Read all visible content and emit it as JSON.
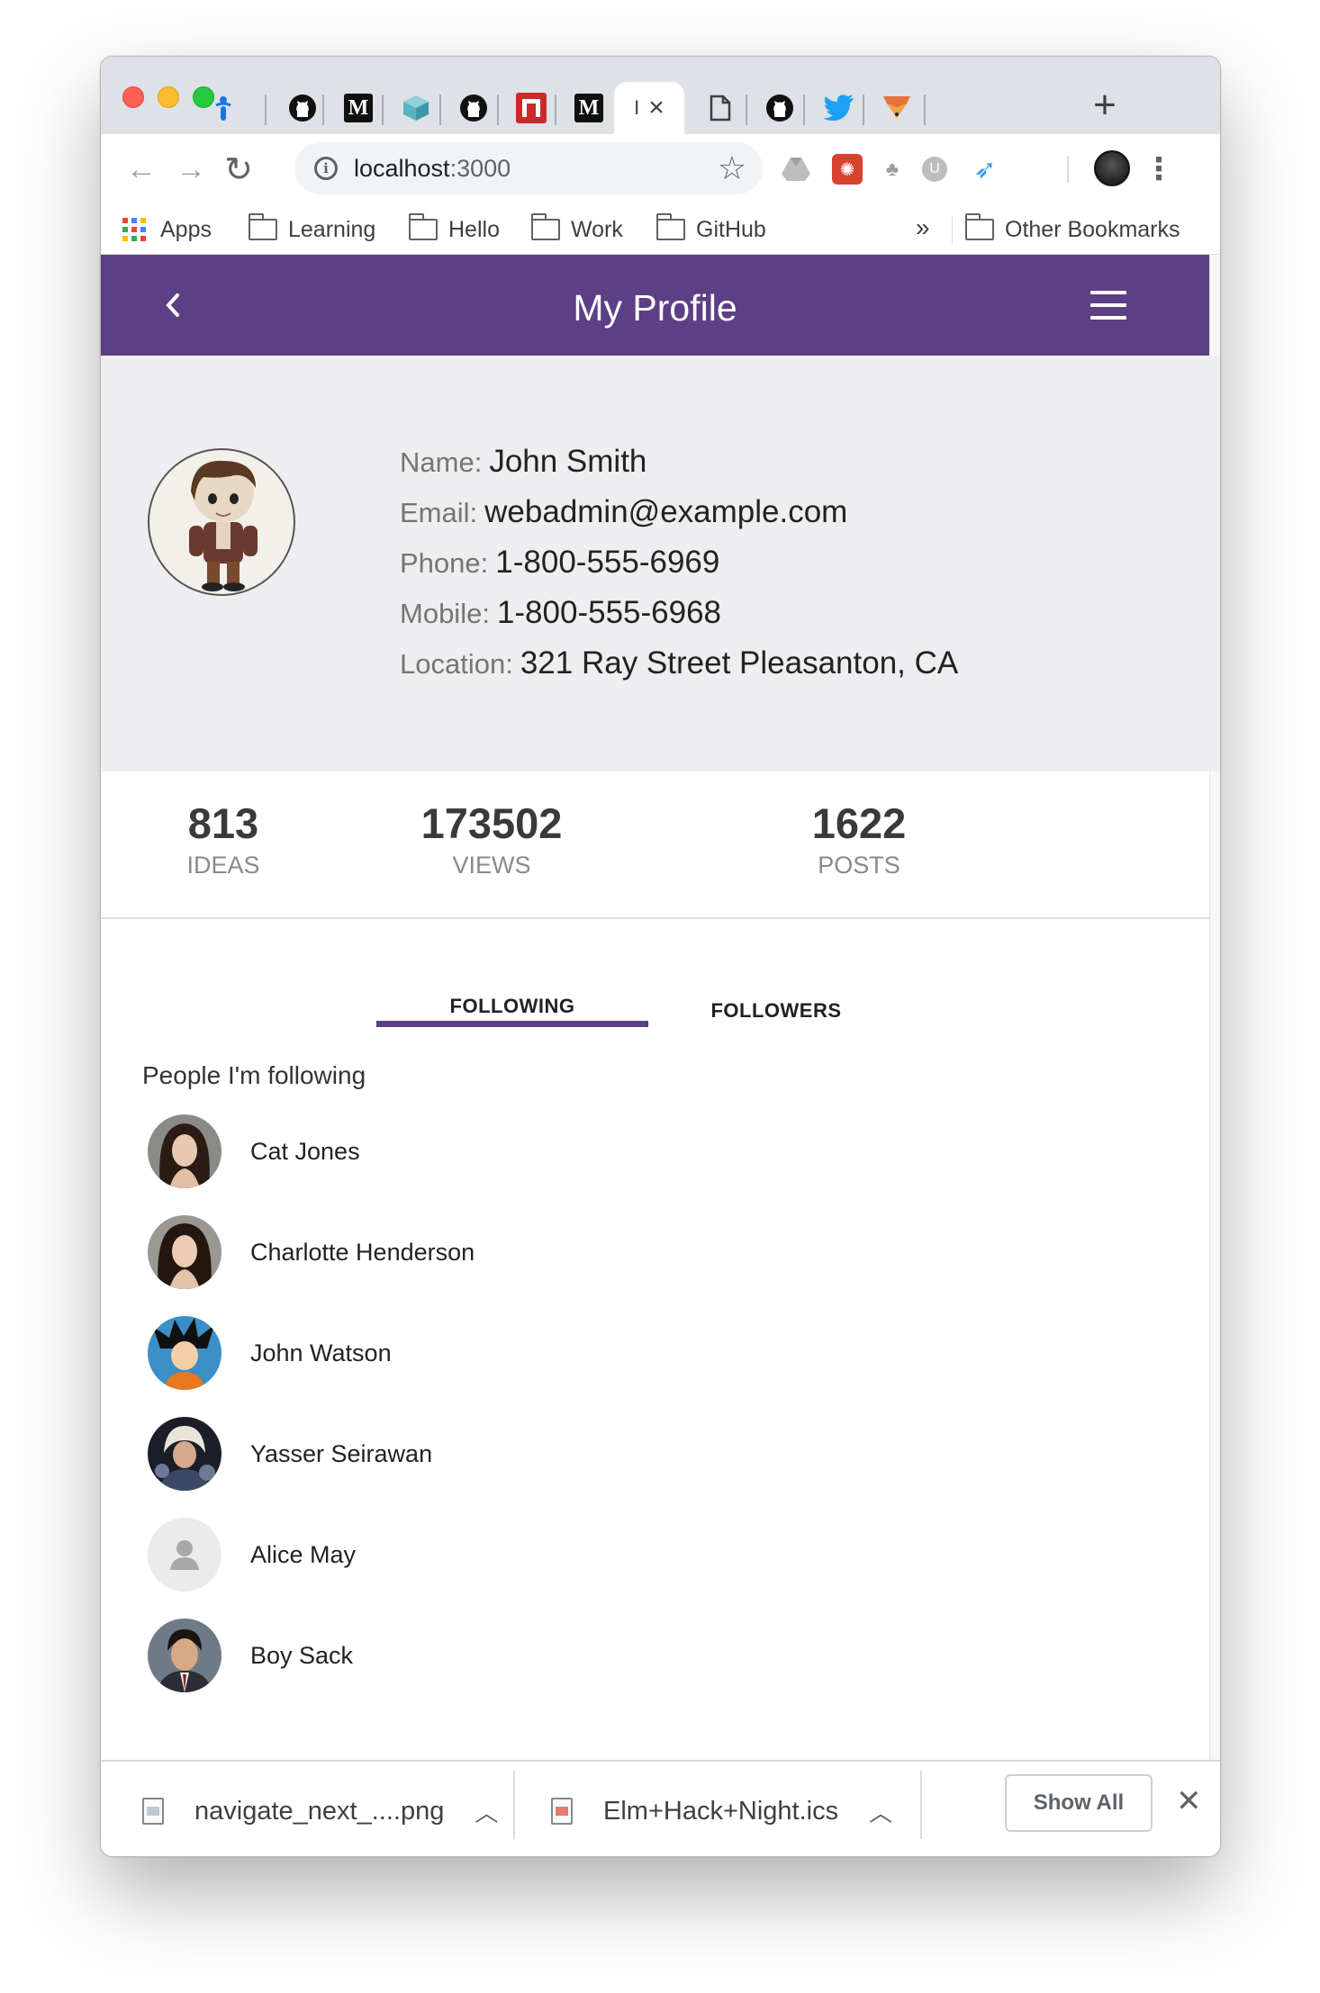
{
  "browser": {
    "active_tab_truncated": "I",
    "url_host": "localhost",
    "url_port": ":3000",
    "bookmarks": [
      {
        "label": "Apps",
        "type": "apps"
      },
      {
        "label": "Learning",
        "type": "folder"
      },
      {
        "label": "Hello",
        "type": "folder"
      },
      {
        "label": "Work",
        "type": "folder"
      },
      {
        "label": "GitHub",
        "type": "folder"
      }
    ],
    "overflow_glyph": "»",
    "other_bookmarks": "Other Bookmarks"
  },
  "app": {
    "title": "My Profile",
    "accent_color": "#5c3f84"
  },
  "profile": {
    "name_label": "Name:",
    "name": "John Smith",
    "email_label": "Email:",
    "email": "webadmin@example.com",
    "phone_label": "Phone:",
    "phone": "1-800-555-6969",
    "mobile_label": "Mobile:",
    "mobile": "1-800-555-6968",
    "location_label": "Location:",
    "location": "321 Ray Street Pleasanton, CA"
  },
  "stats": [
    {
      "value": "813",
      "label": "IDEAS"
    },
    {
      "value": "173502",
      "label": "VIEWS"
    },
    {
      "value": "1622",
      "label": "POSTS"
    }
  ],
  "tabs": [
    {
      "label": "FOLLOWING",
      "active": true
    },
    {
      "label": "FOLLOWERS",
      "active": false
    }
  ],
  "following": {
    "heading": "People I'm following",
    "people": [
      {
        "name": "Cat Jones"
      },
      {
        "name": "Charlotte Henderson"
      },
      {
        "name": "John Watson"
      },
      {
        "name": "Yasser Seirawan"
      },
      {
        "name": "Alice May"
      },
      {
        "name": "Boy Sack"
      }
    ]
  },
  "downloads": {
    "items": [
      {
        "name": "navigate_next_....png"
      },
      {
        "name": "Elm+Hack+Night.ics"
      }
    ],
    "show_all": "Show All"
  }
}
